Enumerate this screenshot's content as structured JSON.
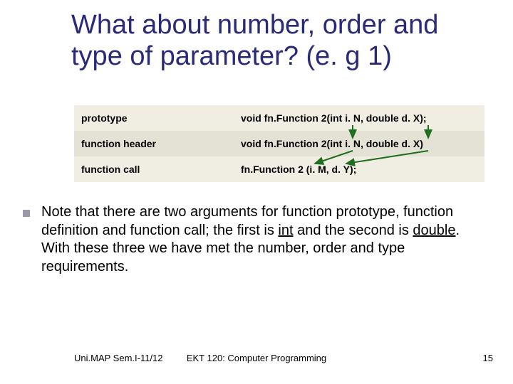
{
  "title": "What about number, order and type of parameter? (e. g 1)",
  "table": {
    "rows": [
      {
        "label": "prototype",
        "code": "void fn.Function 2(int i. N, double d. X);"
      },
      {
        "label": "function header",
        "code": "void fn.Function 2(int i. N, double d. X)"
      },
      {
        "label": "function call",
        "code": "fn.Function 2 (i. M, d. Y);"
      }
    ]
  },
  "body": {
    "pre1": "Note that there are two arguments for function prototype, function definition and function call; the first is ",
    "int": "int",
    "mid": " and the second is ",
    "double": "double",
    "post": ". With these three we have met the number, order and type requirements."
  },
  "footer": {
    "left": "Uni.MAP Sem.I-11/12",
    "center": "EKT 120: Computer Programming",
    "right": "15"
  },
  "colors": {
    "arrow": "#1f6f1f"
  }
}
